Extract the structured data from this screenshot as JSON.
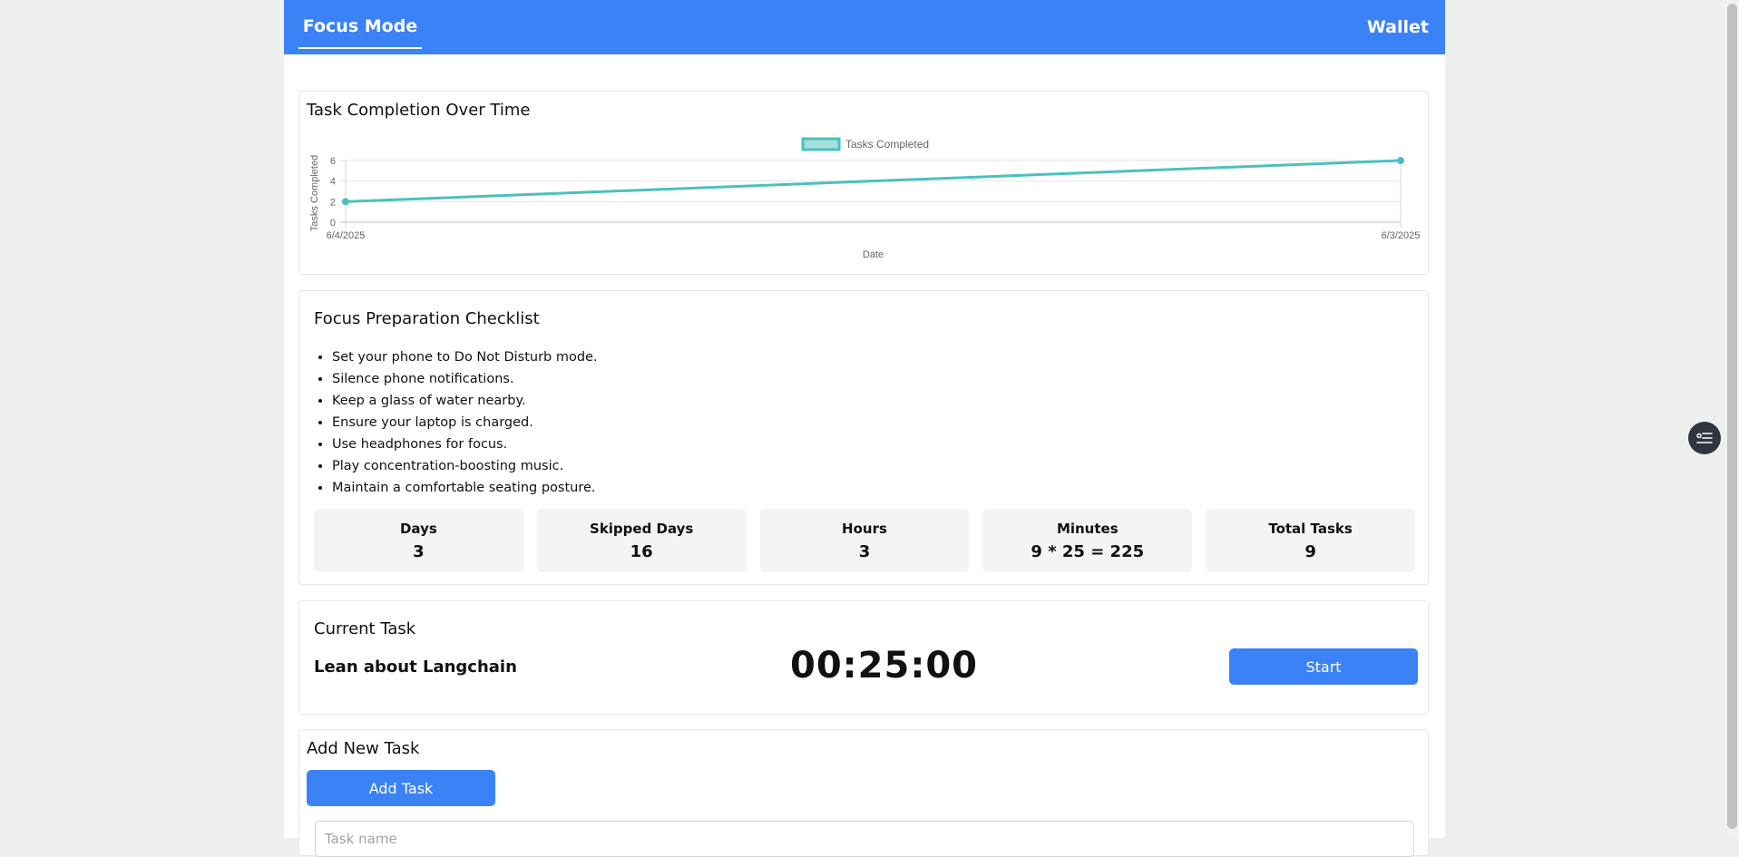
{
  "nav": {
    "focus_tab": "Focus Mode",
    "wallet_tab": "Wallet"
  },
  "chart_card": {
    "title": "Task Completion Over Time"
  },
  "chart_data": {
    "type": "line",
    "title": "Task Completion Over Time",
    "xlabel": "Date",
    "ylabel": "Tasks Completed",
    "categories": [
      "6/4/2025",
      "6/3/2025"
    ],
    "series": [
      {
        "name": "Tasks Completed",
        "values": [
          2,
          6
        ]
      }
    ],
    "ylim": [
      0,
      6
    ],
    "yticks": [
      0,
      2,
      4,
      6
    ],
    "grid": true,
    "legend": "top",
    "color": "#4bc0c0"
  },
  "checklist": {
    "title": "Focus Preparation Checklist",
    "items": [
      "Set your phone to Do Not Disturb mode.",
      "Silence phone notifications.",
      "Keep a glass of water nearby.",
      "Ensure your laptop is charged.",
      "Use headphones for focus.",
      "Play concentration-boosting music.",
      "Maintain a comfortable seating posture."
    ]
  },
  "stats": [
    {
      "label": "Days",
      "value": "3"
    },
    {
      "label": "Skipped Days",
      "value": "16"
    },
    {
      "label": "Hours",
      "value": "3"
    },
    {
      "label": "Minutes",
      "value": "9 * 25 = 225"
    },
    {
      "label": "Total Tasks",
      "value": "9"
    }
  ],
  "current_task": {
    "heading": "Current Task",
    "name": "Lean about Langchain",
    "timer": "00:25:00",
    "start_label": "Start"
  },
  "add_task": {
    "heading": "Add New Task",
    "button_label": "Add Task",
    "input_placeholder": "Task name"
  },
  "icons": {
    "floating": "task-list-icon"
  },
  "colors": {
    "primary": "#3b82f6",
    "series": "#4bc0c0"
  }
}
